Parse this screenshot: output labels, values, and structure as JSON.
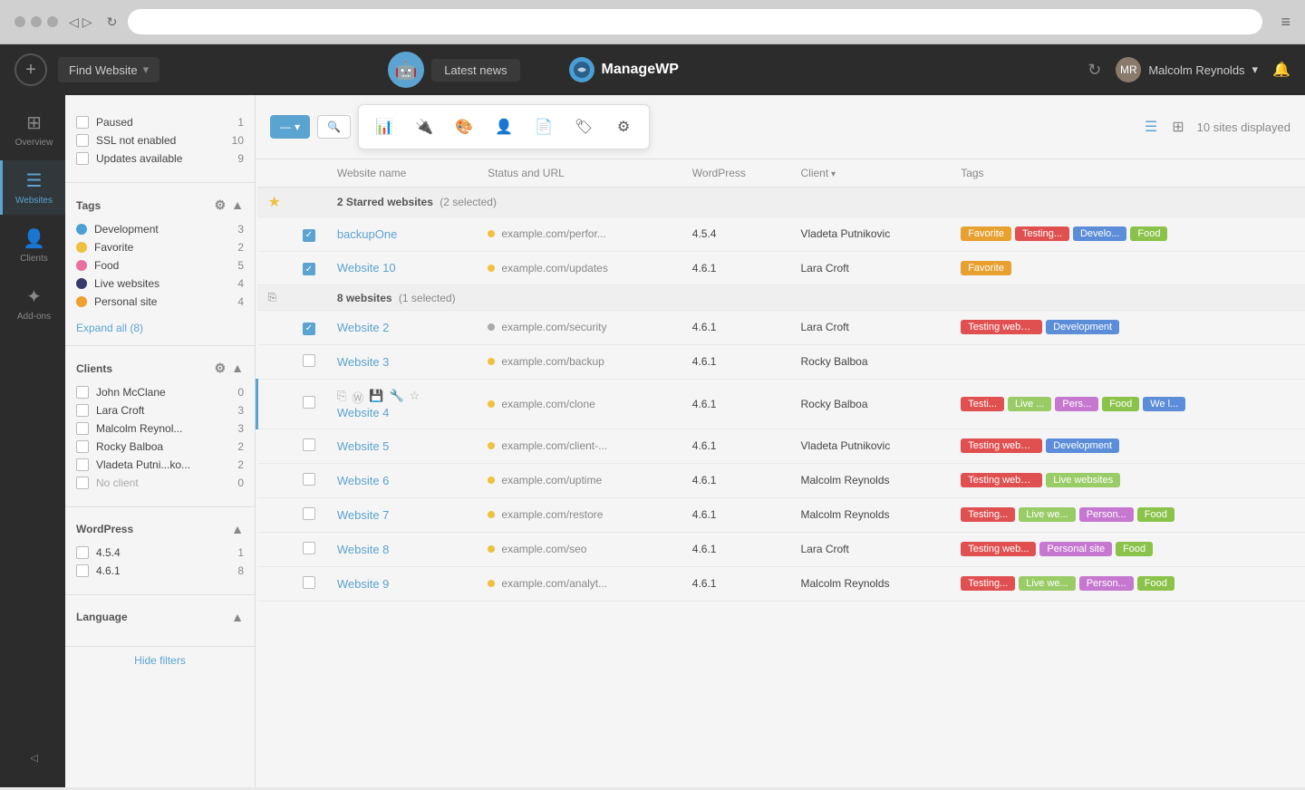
{
  "browser": {
    "addressbar_value": "",
    "menu_icon": "≡"
  },
  "topnav": {
    "find_website_label": "Find Website",
    "latest_news_label": "Latest news",
    "logo_text": "ManageWP",
    "user_name": "Malcolm Reynolds",
    "user_arrow": "▾",
    "refresh_icon": "↻",
    "bell_icon": "🔔"
  },
  "icon_sidebar": {
    "items": [
      {
        "id": "overview",
        "label": "Overview",
        "icon": "⊞"
      },
      {
        "id": "websites",
        "label": "Websites",
        "icon": "☰",
        "active": true
      },
      {
        "id": "clients",
        "label": "Clients",
        "icon": "👤"
      },
      {
        "id": "add-ons",
        "label": "Add-ons",
        "icon": "✦"
      }
    ]
  },
  "filters": {
    "status_filters": [
      {
        "id": "paused",
        "label": "Paused",
        "count": 1
      },
      {
        "id": "ssl-not-enabled",
        "label": "SSL not enabled",
        "count": 10
      },
      {
        "id": "updates-available",
        "label": "Updates available",
        "count": 9
      }
    ],
    "tags_section_label": "Tags",
    "tags": [
      {
        "id": "development",
        "label": "Development",
        "count": 3,
        "color": "#4a9fd4"
      },
      {
        "id": "favorite",
        "label": "Favorite",
        "count": 2,
        "color": "#f0c040"
      },
      {
        "id": "food",
        "label": "Food",
        "count": 5,
        "color": "#e870a0"
      },
      {
        "id": "live-websites",
        "label": "Live websites",
        "count": 4,
        "color": "#3a3a6a"
      },
      {
        "id": "personal-site",
        "label": "Personal site",
        "count": 4,
        "color": "#f0a030"
      }
    ],
    "expand_all_label": "Expand all (8)",
    "clients_section_label": "Clients",
    "clients": [
      {
        "id": "john-mcclane",
        "label": "John McClane",
        "count": 0
      },
      {
        "id": "lara-croft",
        "label": "Lara Croft",
        "count": 3
      },
      {
        "id": "malcolm-reynolds",
        "label": "Malcolm Reynol...",
        "count": 3
      },
      {
        "id": "rocky-balboa",
        "label": "Rocky Balboa",
        "count": 2
      },
      {
        "id": "vladeta-putnikovic",
        "label": "Vladeta Putni...ko...",
        "count": 2
      },
      {
        "id": "no-client",
        "label": "No client",
        "count": 0
      }
    ],
    "wordpress_section_label": "WordPress",
    "wordpress_versions": [
      {
        "id": "v454",
        "label": "4.5.4",
        "count": 1
      },
      {
        "id": "v461",
        "label": "4.6.1",
        "count": 8
      }
    ],
    "language_section_label": "Language",
    "hide_filters_label": "Hide filters"
  },
  "toolbar": {
    "action_dropdown_label": "—",
    "search_icon": "🔍",
    "actions": [
      {
        "id": "updates",
        "icon": "📊",
        "label": "Updates"
      },
      {
        "id": "plugins",
        "icon": "🔌",
        "label": "Plugins"
      },
      {
        "id": "themes",
        "icon": "🎨",
        "label": "Themes"
      },
      {
        "id": "users",
        "icon": "👤",
        "label": "Users"
      },
      {
        "id": "pages",
        "icon": "📄",
        "label": "Pages"
      },
      {
        "id": "tags-action",
        "icon": "🏷",
        "label": "Tags"
      },
      {
        "id": "settings",
        "icon": "⚙",
        "label": "Settings"
      }
    ],
    "view_list_icon": "☰",
    "view_grid_icon": "⊞",
    "sites_displayed": "10 sites displayed"
  },
  "table": {
    "headers": [
      {
        "id": "star",
        "label": ""
      },
      {
        "id": "check",
        "label": ""
      },
      {
        "id": "name",
        "label": "Website name"
      },
      {
        "id": "status",
        "label": "Status and URL"
      },
      {
        "id": "wordpress",
        "label": "WordPress"
      },
      {
        "id": "client",
        "label": "Client",
        "sortable": true
      },
      {
        "id": "tags",
        "label": "Tags"
      }
    ],
    "groups": [
      {
        "id": "starred",
        "label": "2 Starred websites",
        "sublabel": "(2 selected)",
        "starred": true,
        "sites": [
          {
            "id": "backupone",
            "name": "backupOne",
            "url": "example.com/perfor...",
            "url_status": "orange",
            "wp": "4.5.4",
            "client": "Vladeta Putnikovic",
            "checked": true,
            "tags": [
              {
                "label": "Favorite",
                "class": "tag-favorite"
              },
              {
                "label": "Testing...",
                "class": "tag-testing"
              },
              {
                "label": "Develo...",
                "class": "tag-development"
              },
              {
                "label": "Food",
                "class": "tag-food"
              }
            ]
          },
          {
            "id": "website10",
            "name": "Website 10",
            "url": "example.com/updates",
            "url_status": "orange",
            "wp": "4.6.1",
            "client": "Lara Croft",
            "checked": true,
            "tags": [
              {
                "label": "Favorite",
                "class": "tag-favorite"
              }
            ]
          }
        ]
      },
      {
        "id": "websites",
        "label": "8 websites",
        "sublabel": "(1 selected)",
        "starred": false,
        "sites": [
          {
            "id": "website2",
            "name": "Website 2",
            "url": "example.com/security",
            "url_status": "gray",
            "wp": "4.6.1",
            "client": "Lara Croft",
            "checked": true,
            "tags": [
              {
                "label": "Testing websites",
                "class": "tag-testing"
              },
              {
                "label": "Development",
                "class": "tag-development"
              }
            ]
          },
          {
            "id": "website3",
            "name": "Website 3",
            "url": "example.com/backup",
            "url_status": "orange",
            "wp": "4.6.1",
            "client": "Rocky Balboa",
            "checked": false,
            "tags": []
          },
          {
            "id": "website4",
            "name": "Website 4",
            "url": "example.com/clone",
            "url_status": "orange",
            "wp": "4.6.1",
            "client": "Rocky Balboa",
            "checked": false,
            "highlighted": true,
            "has_actions": true,
            "tags": [
              {
                "label": "Testi...",
                "class": "tag-testing"
              },
              {
                "label": "Live ...",
                "class": "tag-live"
              },
              {
                "label": "Pers...",
                "class": "tag-personal"
              },
              {
                "label": "Food",
                "class": "tag-food"
              },
              {
                "label": "We l...",
                "class": "tag-development"
              }
            ]
          },
          {
            "id": "website5",
            "name": "Website 5",
            "url": "example.com/client-...",
            "url_status": "orange",
            "wp": "4.6.1",
            "client": "Vladeta Putnikovic",
            "checked": false,
            "tags": [
              {
                "label": "Testing websites",
                "class": "tag-testing"
              },
              {
                "label": "Development",
                "class": "tag-development"
              }
            ]
          },
          {
            "id": "website6",
            "name": "Website 6",
            "url": "example.com/uptime",
            "url_status": "orange",
            "wp": "4.6.1",
            "client": "Malcolm Reynolds",
            "checked": false,
            "tags": [
              {
                "label": "Testing websites",
                "class": "tag-testing"
              },
              {
                "label": "Live websites",
                "class": "tag-live"
              }
            ]
          },
          {
            "id": "website7",
            "name": "Website 7",
            "url": "example.com/restore",
            "url_status": "orange",
            "wp": "4.6.1",
            "client": "Malcolm Reynolds",
            "checked": false,
            "tags": [
              {
                "label": "Testing...",
                "class": "tag-testing"
              },
              {
                "label": "Live we...",
                "class": "tag-live"
              },
              {
                "label": "Person...",
                "class": "tag-personal"
              },
              {
                "label": "Food",
                "class": "tag-food"
              }
            ]
          },
          {
            "id": "website8",
            "name": "Website 8",
            "url": "example.com/seo",
            "url_status": "orange",
            "wp": "4.6.1",
            "client": "Lara Croft",
            "checked": false,
            "tags": [
              {
                "label": "Testing web...",
                "class": "tag-testing"
              },
              {
                "label": "Personal site",
                "class": "tag-personal"
              },
              {
                "label": "Food",
                "class": "tag-food"
              }
            ]
          },
          {
            "id": "website9",
            "name": "Website 9",
            "url": "example.com/analyt...",
            "url_status": "orange",
            "wp": "4.6.1",
            "client": "Malcolm Reynolds",
            "checked": false,
            "tags": [
              {
                "label": "Testing...",
                "class": "tag-testing"
              },
              {
                "label": "Live we...",
                "class": "tag-live"
              },
              {
                "label": "Person...",
                "class": "tag-personal"
              },
              {
                "label": "Food",
                "class": "tag-food"
              }
            ]
          }
        ]
      }
    ]
  }
}
